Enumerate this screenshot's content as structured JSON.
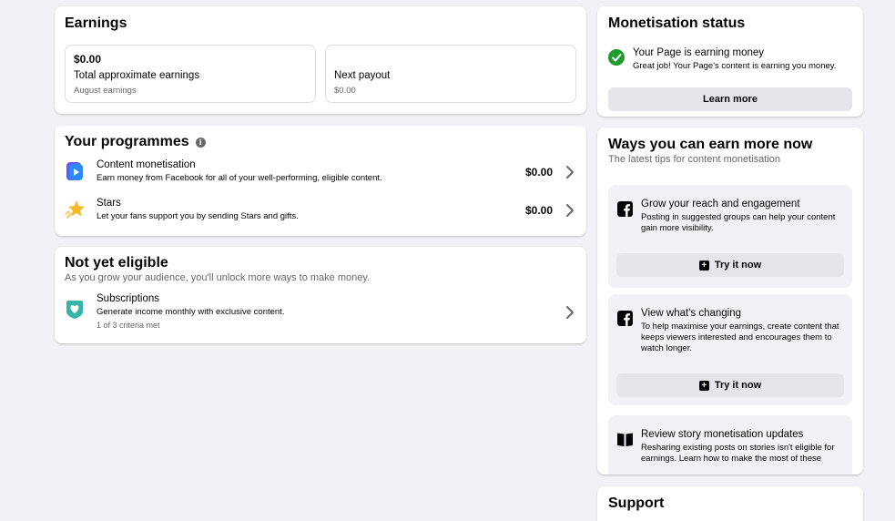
{
  "earnings": {
    "title": "Earnings",
    "total": {
      "amount": "$0.00",
      "label": "Total approximate earnings",
      "sub": "August earnings"
    },
    "payout": {
      "label": "Next payout",
      "sub": "$0.00"
    }
  },
  "programmes": {
    "title": "Your programmes",
    "info_icon": "info-icon",
    "items": [
      {
        "name": "Content monetisation",
        "desc": "Earn money from Facebook for all of your well-performing, eligible content.",
        "amount": "$0.00",
        "icon": "content-monetisation-icon"
      },
      {
        "name": "Stars",
        "desc": "Let your fans support you by sending Stars and gifts.",
        "amount": "$0.00",
        "icon": "star-icon"
      }
    ]
  },
  "not_eligible": {
    "title": "Not yet eligible",
    "subtitle": "As you grow your audience, you'll unlock more ways to make money.",
    "items": [
      {
        "name": "Subscriptions",
        "desc": "Generate income monthly with exclusive content.",
        "criteria": "1 of 3 criteria met",
        "icon": "subscriptions-heart-icon"
      }
    ]
  },
  "status": {
    "title": "Monetisation status",
    "headline": "Your Page is earning money",
    "sub": "Great job! Your Page's content is earning you money.",
    "button": "Learn more",
    "status_color": "#1f9d2c"
  },
  "ways": {
    "title": "Ways you can earn more now",
    "subtitle": "The latest tips for content monetisation",
    "tips": [
      {
        "title": "Grow your reach and engagement",
        "desc": "Posting in suggested groups can help your content gain more visibility.",
        "button": "Try it now",
        "icon": "facebook-icon"
      },
      {
        "title": "View what's changing",
        "desc": "To help maximise your earnings, create content that keeps viewers interested and encourages them to watch longer.",
        "button": "Try it now",
        "icon": "facebook-icon"
      },
      {
        "title": "Review story monetisation updates",
        "desc": "Resharing existing posts on stories isn't eligible for earnings. Learn how to make the most of these",
        "icon": "book-icon"
      }
    ]
  },
  "support": {
    "title": "Support"
  }
}
